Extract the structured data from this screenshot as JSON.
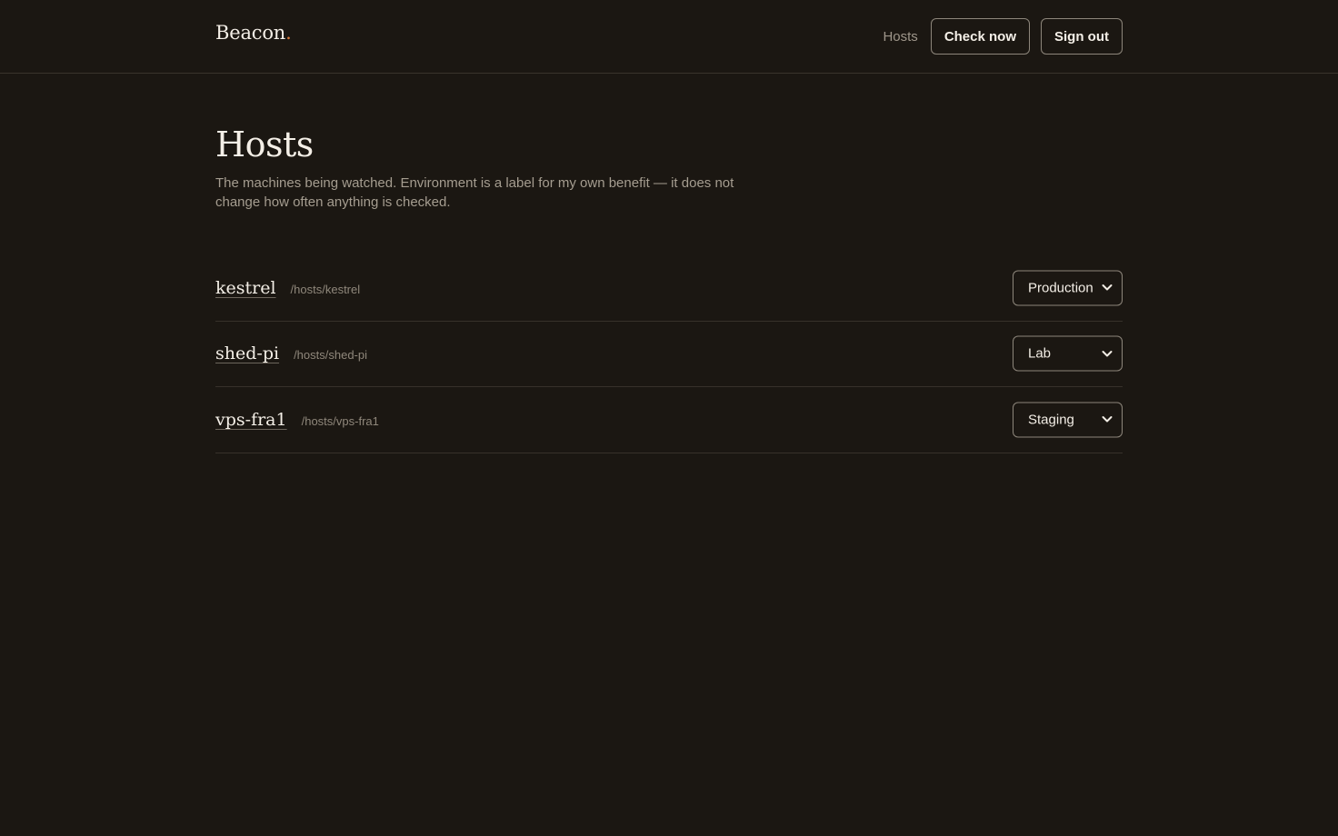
{
  "header": {
    "brand": "Beacon",
    "brand_dot": ".",
    "nav_link": "Hosts",
    "check_now_label": "Check now",
    "sign_out_label": "Sign out"
  },
  "page": {
    "title": "Hosts",
    "description": "The machines being watched. Environment is a label for my own benefit — it does not change how often anything is checked."
  },
  "hosts": [
    {
      "name": "kestrel",
      "path": "/hosts/kestrel",
      "environment": "Production"
    },
    {
      "name": "shed-pi",
      "path": "/hosts/shed-pi",
      "environment": "Lab"
    },
    {
      "name": "vps-fra1",
      "path": "/hosts/vps-fra1",
      "environment": "Staging"
    }
  ],
  "colors": {
    "background": "#1b1712",
    "accent": "#d8793a",
    "text": "#f4efe7",
    "muted": "#a59d90"
  },
  "icons": {
    "select_chevron": "chevron-down-icon"
  }
}
